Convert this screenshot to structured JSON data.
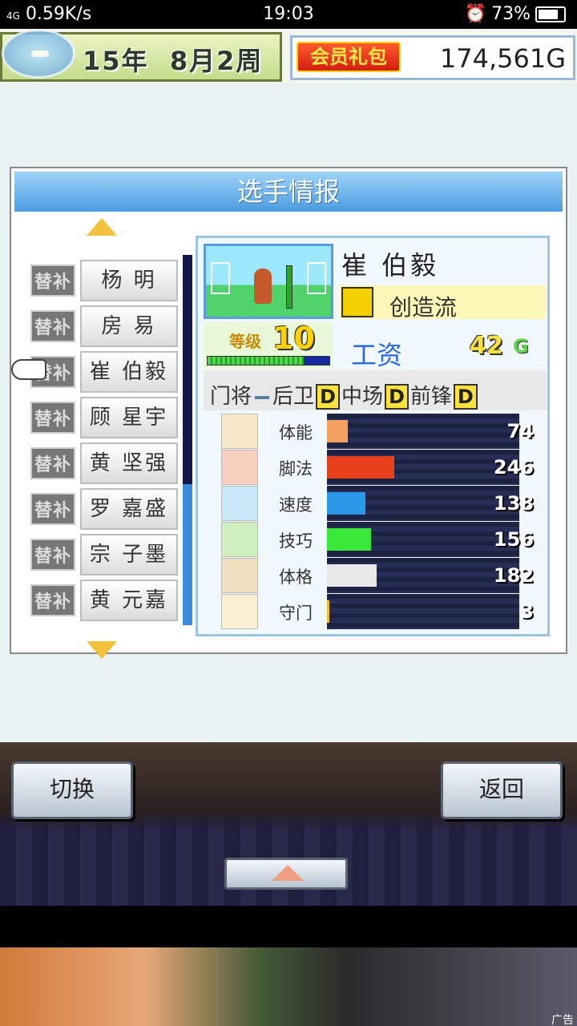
{
  "status_bar": {
    "signal": "4G",
    "speed": "0.59K/s",
    "time": "19:03",
    "battery": "73%"
  },
  "header": {
    "year_label": "15年",
    "date_label": "8月2周",
    "vip_label": "会员礼包",
    "gold": "174,561G"
  },
  "panel": {
    "title": "选手情报"
  },
  "players": [
    {
      "tag": "替补",
      "name": "杨 明"
    },
    {
      "tag": "替补",
      "name": "房 易"
    },
    {
      "tag": "替补",
      "name": "崔 伯毅"
    },
    {
      "tag": "替补",
      "name": "顾 星宇"
    },
    {
      "tag": "替补",
      "name": "黄 坚强"
    },
    {
      "tag": "替补",
      "name": "罗 嘉盛"
    },
    {
      "tag": "替补",
      "name": "宗 子墨"
    },
    {
      "tag": "替补",
      "name": "黄 元嘉"
    }
  ],
  "selected": {
    "name": "崔 伯毅",
    "style": "创造流",
    "level_label": "等级",
    "level": "10",
    "salary_label": "工资",
    "salary": "42",
    "salary_unit": "G",
    "positions": [
      {
        "name": "门将",
        "grade": "-"
      },
      {
        "name": "后卫",
        "grade": "D"
      },
      {
        "name": "中场",
        "grade": "D"
      },
      {
        "name": "前锋",
        "grade": "D"
      }
    ]
  },
  "stats": [
    {
      "label": "体能",
      "value": "74",
      "color": "#f4a060",
      "fraction": 0.11
    },
    {
      "label": "脚法",
      "value": "246",
      "color": "#e8401a",
      "fraction": 0.35
    },
    {
      "label": "速度",
      "value": "138",
      "color": "#2a9ae8",
      "fraction": 0.2
    },
    {
      "label": "技巧",
      "value": "156",
      "color": "#3ae83a",
      "fraction": 0.23
    },
    {
      "label": "体格",
      "value": "182",
      "color": "#e8e8e8",
      "fraction": 0.26
    },
    {
      "label": "守门",
      "value": "3",
      "color": "#f4c020",
      "fraction": 0.01
    }
  ],
  "buttons": {
    "switch": "切换",
    "back": "返回"
  },
  "ad": {
    "label": "广告"
  }
}
